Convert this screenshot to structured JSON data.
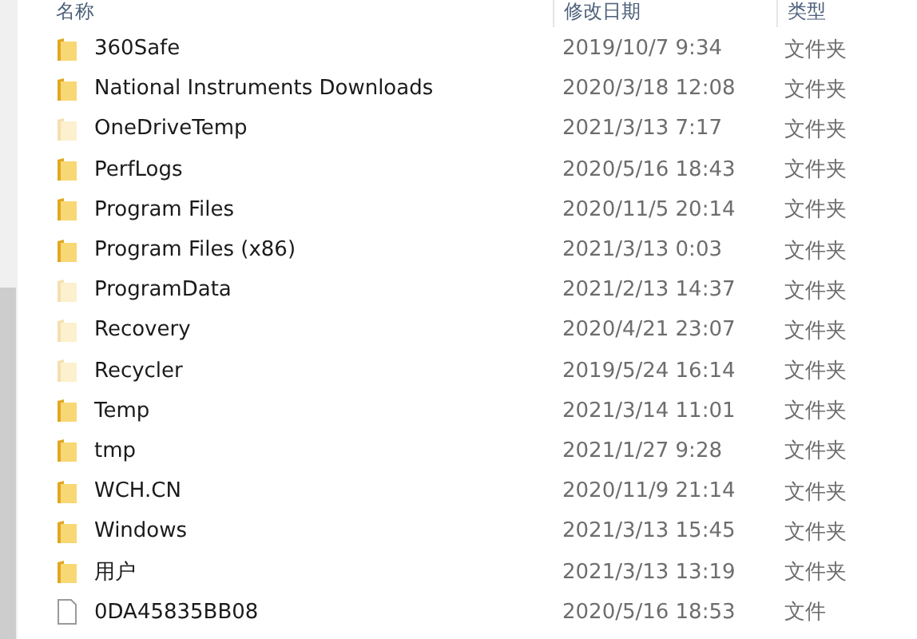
{
  "columns": [
    "名称",
    "修改日期",
    "类型"
  ],
  "rows": [
    {
      "kind": "folder",
      "hidden": false,
      "name": "360Safe",
      "date": "2019/10/7 9:34",
      "type": "文件夹"
    },
    {
      "kind": "folder",
      "hidden": false,
      "name": "National Instruments Downloads",
      "date": "2020/3/18 12:08",
      "type": "文件夹"
    },
    {
      "kind": "folder",
      "hidden": true,
      "name": "OneDriveTemp",
      "date": "2021/3/13 7:17",
      "type": "文件夹"
    },
    {
      "kind": "folder",
      "hidden": false,
      "name": "PerfLogs",
      "date": "2020/5/16 18:43",
      "type": "文件夹"
    },
    {
      "kind": "folder",
      "hidden": false,
      "name": "Program Files",
      "date": "2020/11/5 20:14",
      "type": "文件夹"
    },
    {
      "kind": "folder",
      "hidden": false,
      "name": "Program Files (x86)",
      "date": "2021/3/13 0:03",
      "type": "文件夹"
    },
    {
      "kind": "folder",
      "hidden": true,
      "name": "ProgramData",
      "date": "2021/2/13 14:37",
      "type": "文件夹"
    },
    {
      "kind": "folder",
      "hidden": true,
      "name": "Recovery",
      "date": "2020/4/21 23:07",
      "type": "文件夹"
    },
    {
      "kind": "folder",
      "hidden": true,
      "name": "Recycler",
      "date": "2019/5/24 16:14",
      "type": "文件夹"
    },
    {
      "kind": "folder",
      "hidden": false,
      "name": "Temp",
      "date": "2021/3/14 11:01",
      "type": "文件夹"
    },
    {
      "kind": "folder",
      "hidden": false,
      "name": "tmp",
      "date": "2021/1/27 9:28",
      "type": "文件夹"
    },
    {
      "kind": "folder",
      "hidden": false,
      "name": "WCH.CN",
      "date": "2020/11/9 21:14",
      "type": "文件夹"
    },
    {
      "kind": "folder",
      "hidden": false,
      "name": "Windows",
      "date": "2021/3/13 15:45",
      "type": "文件夹"
    },
    {
      "kind": "folder",
      "hidden": false,
      "name": "用户",
      "date": "2021/3/13 13:19",
      "type": "文件夹"
    },
    {
      "kind": "file",
      "hidden": false,
      "name": "0DA45835BB08",
      "date": "2020/5/16 18:53",
      "type": "文件"
    }
  ]
}
